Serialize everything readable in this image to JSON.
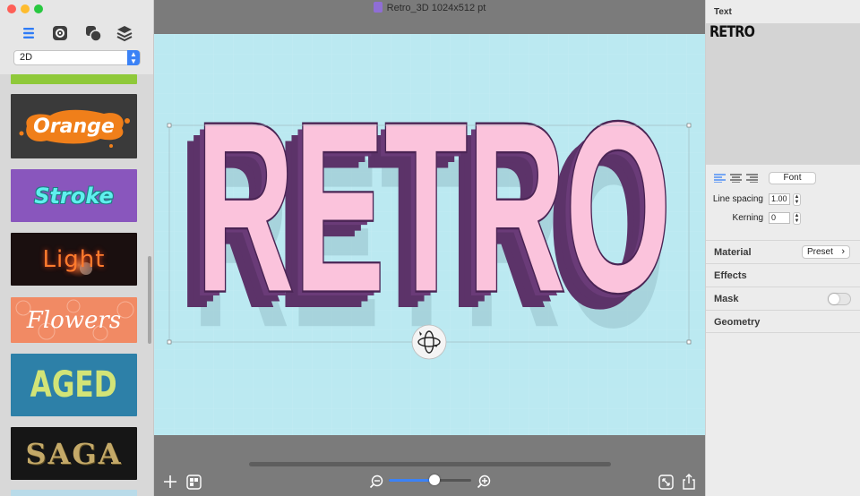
{
  "window": {
    "title": "Retro_3D 1024x512 pt"
  },
  "sidebar": {
    "tools": [
      "list-icon",
      "gear-icon",
      "shapes-icon",
      "layers-icon"
    ],
    "style_select": {
      "value": "2D"
    },
    "styles": [
      {
        "label": "Orange",
        "bg": "#3a3a3a",
        "color": "#ffffff",
        "accent": "#f07f1a"
      },
      {
        "label": "Stroke",
        "bg": "#8956bd",
        "color": "#5ff0ee",
        "accent": "#1f9da0"
      },
      {
        "label": "Light",
        "bg": "#1a0f0f",
        "color": "#ff7b2d",
        "accent": "#d83b16"
      },
      {
        "label": "Flowers",
        "bg": "#f18a64",
        "color": "#ffffff",
        "accent": "#f5a888"
      },
      {
        "label": "AGED",
        "bg": "#2d80a8",
        "color": "#d2e477",
        "accent": "#226a8e"
      },
      {
        "label": "SAGA",
        "bg": "#161616",
        "color": "#c4a968",
        "accent": "#7d6a3c"
      }
    ]
  },
  "canvas": {
    "text": "RETRO",
    "background": "#bbe9f1",
    "face_color": "#fbc3dc",
    "extrude_color": "#5c3369",
    "outline_color": "#4a2454"
  },
  "inspector": {
    "text_header": "Text",
    "text_value": "RETRO",
    "font_button": "Font",
    "line_spacing_label": "Line spacing",
    "line_spacing_value": "1.00",
    "kerning_label": "Kerning",
    "kerning_value": "0",
    "sections": {
      "material": "Material",
      "preset": "Preset",
      "effects": "Effects",
      "mask": "Mask",
      "geometry": "Geometry"
    },
    "mask_enabled": false
  },
  "zoom": {
    "level": 0.55
  }
}
